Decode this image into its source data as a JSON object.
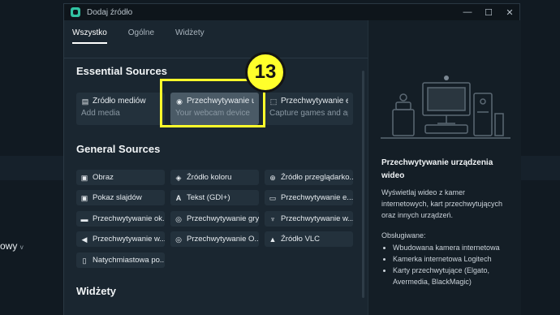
{
  "background": {
    "label": "owy",
    "caret": "v"
  },
  "window": {
    "title": "Dodaj źródło",
    "controls": [
      "—",
      "☐",
      "✕"
    ]
  },
  "tabs": [
    {
      "label": "Wszystko"
    },
    {
      "label": "Ogólne"
    },
    {
      "label": "Widżety"
    }
  ],
  "essential": {
    "title": "Essential Sources",
    "cards": [
      {
        "name": "Źródło mediów",
        "sub": "Add media"
      },
      {
        "name": "Przechwytywanie ur...",
        "sub": "Your webcam device"
      },
      {
        "name": "Przechwytywanie ek...",
        "sub": "Capture games and apps"
      }
    ]
  },
  "general": {
    "title": "General Sources",
    "items": [
      {
        "label": "Obraz",
        "icon": "image-icon"
      },
      {
        "label": "Źródło koloru",
        "icon": "paint-bucket-icon"
      },
      {
        "label": "Źródło przeglądarko...",
        "icon": "globe-icon"
      },
      {
        "label": "Pokaz slajdów",
        "icon": "slideshow-icon"
      },
      {
        "label": "Tekst (GDI+)",
        "icon": "text-icon"
      },
      {
        "label": "Przechwytywanie e...",
        "icon": "monitor-icon"
      },
      {
        "label": "Przechwytywanie ok...",
        "icon": "window-icon"
      },
      {
        "label": "Przechwytywanie gry",
        "icon": "gamepad-icon"
      },
      {
        "label": "Przechwytywanie w...",
        "icon": "microphone-icon"
      },
      {
        "label": "Przechwytywanie w...",
        "icon": "speaker-icon"
      },
      {
        "label": "Przechwytywanie O...",
        "icon": "gamepad-icon"
      },
      {
        "label": "Źródło VLC",
        "icon": "vlc-icon"
      },
      {
        "label": "Natychmiastowa po...",
        "icon": "document-icon"
      }
    ]
  },
  "widgets": {
    "title": "Widżety"
  },
  "annotation": {
    "number": "13"
  },
  "detail": {
    "title": "Przechwytywanie urządzenia wideo",
    "description": "Wyświetlaj wideo z kamer internetowych, kart przechwytujących oraz innych urządzeń.",
    "supported_label": "Obsługiwane:",
    "supported": [
      "Wbudowana kamera internetowa",
      "Kamerka internetowa Logitech",
      "Karty przechwytujące (Elgato, Avermedia, BlackMagic)"
    ]
  }
}
